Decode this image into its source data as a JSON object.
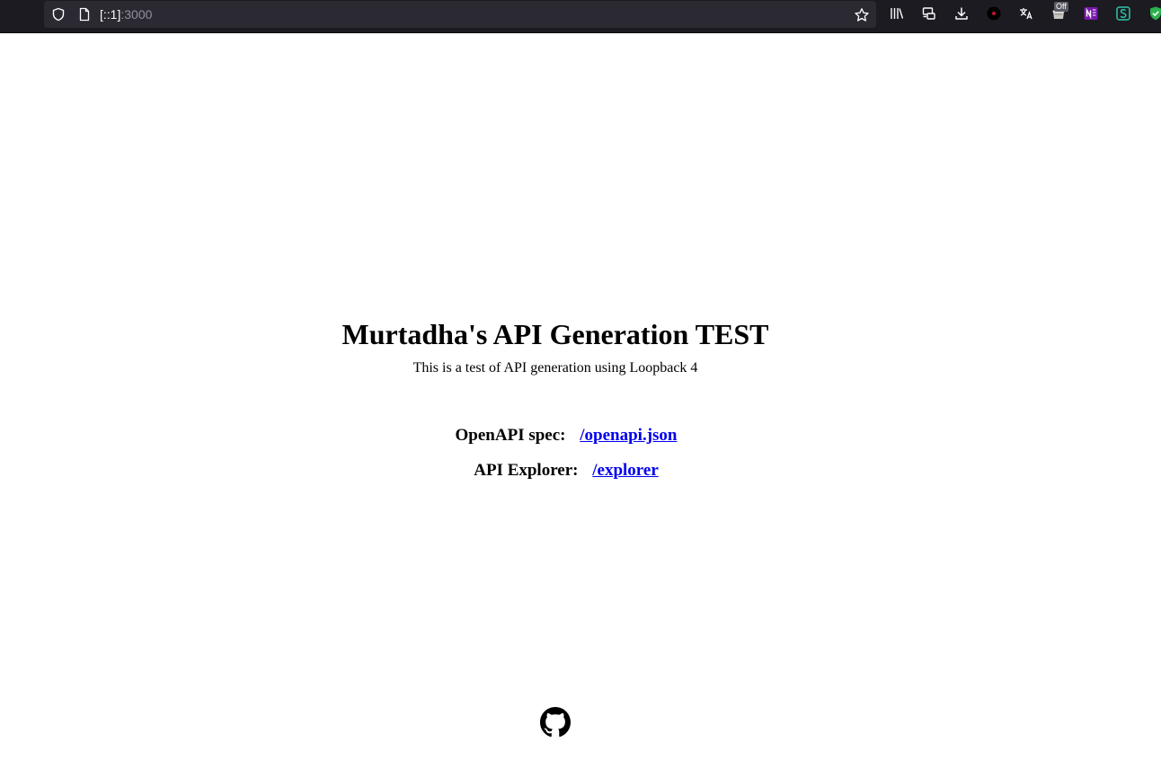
{
  "browser": {
    "url_host": "[::1]",
    "url_port": ":3000",
    "extension_badge": "Off",
    "icons": [
      "shield-icon",
      "page-icon",
      "bookmark-star-icon",
      "library-icon",
      "sync-tabs-icon",
      "download-icon",
      "extension-dark-icon",
      "translate-icon",
      "extension-off-icon",
      "onenote-icon",
      "s-extension-icon",
      "shield-check-icon"
    ],
    "colors": {
      "toolbar": "#1c1b22",
      "urlbar": "#2b2a33",
      "text": "#fbfbfe",
      "muted": "#8f8f9d"
    }
  },
  "page": {
    "title": "Murtadha's API Generation TEST",
    "subtitle": "This is a test of API generation using Loopback 4",
    "links": [
      {
        "label": "OpenAPI spec:",
        "href_text": "/openapi.json"
      },
      {
        "label": "API Explorer:",
        "href_text": "/explorer"
      }
    ],
    "footer_icon": "github-icon",
    "link_color": "#0000ee"
  }
}
